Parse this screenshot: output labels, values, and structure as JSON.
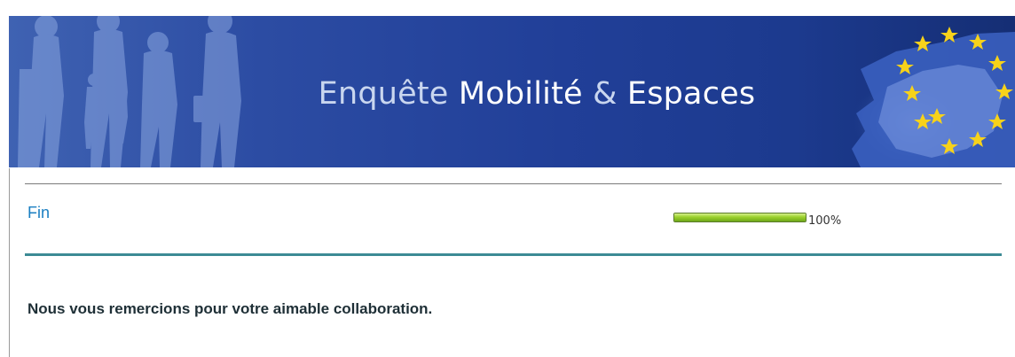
{
  "header": {
    "title_word1": "Enquête",
    "title_word2": "Mobilité",
    "title_amp": "&",
    "title_word3": "Espaces"
  },
  "section": {
    "title": "Fin"
  },
  "progress": {
    "value_percent": 100,
    "label": "100%"
  },
  "message": {
    "text": "Nous vous remercions pour votre aimable collaboration."
  },
  "colors": {
    "banner_blue": "#213f98",
    "section_title": "#1b7fc2",
    "progress_green": "#9bd12d",
    "divider_teal": "#3c8a95"
  }
}
